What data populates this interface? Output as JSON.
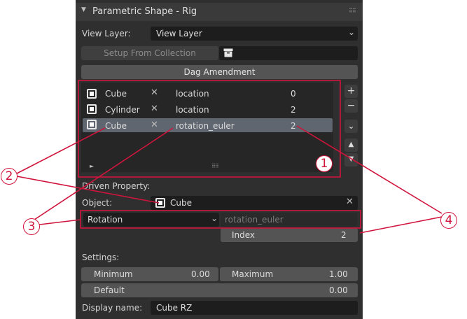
{
  "panel": {
    "title": "Parametric Shape - Rig",
    "view_layer_label": "View Layer:",
    "view_layer_value": "View Layer",
    "setup_button": "Setup From Collection",
    "dag_button": "Dag Amendment"
  },
  "list": {
    "rows": [
      {
        "object": "Cube",
        "property": "location",
        "index": "0",
        "selected": false
      },
      {
        "object": "Cylinder",
        "property": "location",
        "index": "2",
        "selected": false
      },
      {
        "object": "Cube",
        "property": "rotation_euler",
        "index": "2",
        "selected": true
      }
    ]
  },
  "driven": {
    "label": "Driven Property:",
    "object_label": "Object:",
    "object_value": "Cube",
    "type_value": "Rotation",
    "path_value": "rotation_euler",
    "index_label": "Index",
    "index_value": "2"
  },
  "settings": {
    "label": "Settings:",
    "minimum_label": "Minimum",
    "minimum_value": "0.00",
    "maximum_label": "Maximum",
    "maximum_value": "1.00",
    "default_label": "Default",
    "default_value": "0.00",
    "display_name_label": "Display name:",
    "display_name_value": "Cube RZ"
  },
  "annotations": {
    "marker_1": "1",
    "marker_2": "2",
    "marker_3": "3",
    "marker_4": "4",
    "color": "#d0143c"
  },
  "icons": [
    "collapse-arrow-icon",
    "drag-grip-icon",
    "chevron-down-icon",
    "box-icon",
    "object-icon",
    "remove-x-icon",
    "add-icon",
    "remove-icon",
    "move-up-icon",
    "move-down-icon",
    "expand-arrow-icon"
  ]
}
